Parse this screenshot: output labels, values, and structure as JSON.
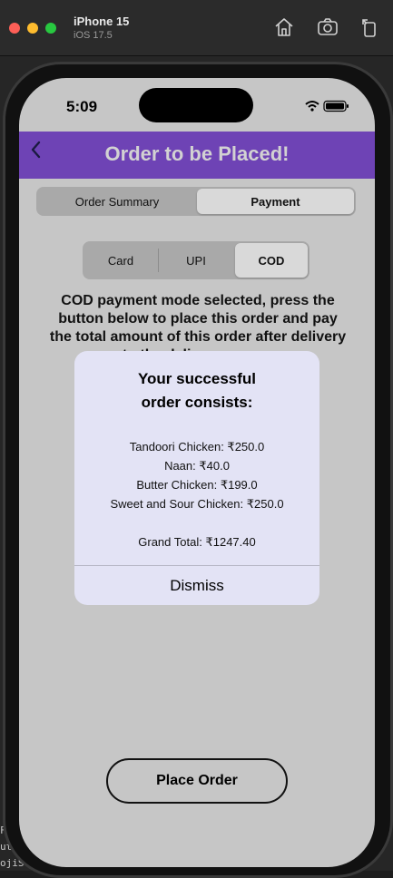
{
  "simulator": {
    "device_name": "iPhone 15",
    "os_version": "iOS 17.5",
    "code_lines": [
      "F",
      "uth",
      "ojiSear"
    ]
  },
  "status_bar": {
    "time": "5:09"
  },
  "navbar": {
    "title": "Order to be Placed!",
    "color": "#6e43b5"
  },
  "tabs": {
    "items": [
      {
        "label": "Order Summary",
        "selected": false
      },
      {
        "label": "Payment",
        "selected": true
      }
    ]
  },
  "payment_methods": {
    "items": [
      {
        "label": "Card",
        "selected": false
      },
      {
        "label": "UPI",
        "selected": false
      },
      {
        "label": "COD",
        "selected": true
      }
    ]
  },
  "description": "COD payment mode selected, press the button below to place this order and pay the total amount of this order after delivery to the delivery person",
  "alert": {
    "title_line1": "Your successful",
    "title_line2": "order consists:",
    "items": [
      "Tandoori Chicken: ₹250.0",
      "Naan: ₹40.0",
      "Butter Chicken: ₹199.0",
      "Sweet and Sour Chicken: ₹250.0"
    ],
    "grand_total": "Grand Total: ₹1247.40",
    "dismiss_label": "Dismiss"
  },
  "place_order_label": "Place Order"
}
